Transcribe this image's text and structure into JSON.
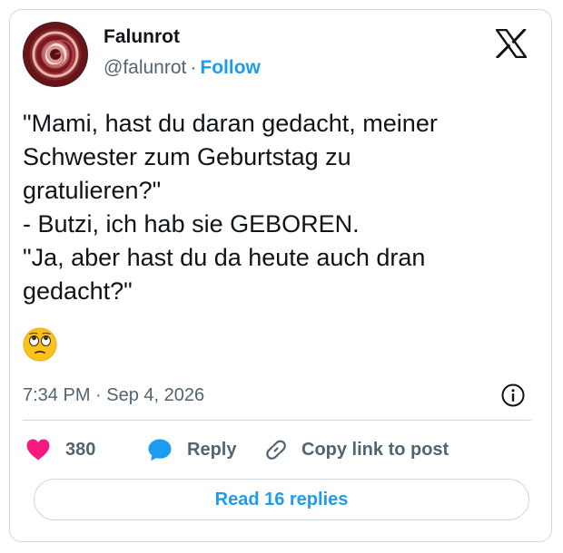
{
  "author": {
    "display_name": "Falunrot",
    "handle": "@falunrot",
    "separator": "·",
    "follow_label": "Follow"
  },
  "tweet": {
    "lines": [
      "\"Mami, hast du daran gedacht, meiner",
      "Schwester zum Geburtstag zu",
      "gratulieren?\"",
      "- Butzi, ich hab sie GEBOREN.",
      "\"Ja, aber hast du da heute auch dran",
      "gedacht?\""
    ],
    "emoji_icon": "face-with-rolling-eyes-icon"
  },
  "meta": {
    "time": "7:34 PM",
    "separator": "·",
    "date": "Sep 4, 2026"
  },
  "actions": {
    "like_count": "380",
    "reply_label": "Reply",
    "copy_label": "Copy link to post"
  },
  "read_replies_label": "Read 16 replies",
  "colors": {
    "accent": "#1d9bf0",
    "heart": "#f91880",
    "text": "#0f1419",
    "muted": "#536471",
    "border": "#cfd9de"
  }
}
